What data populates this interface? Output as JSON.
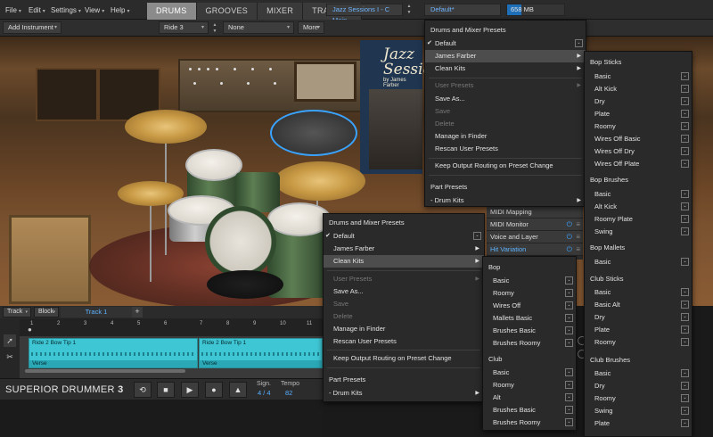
{
  "topbar": {
    "menus": [
      {
        "label": "File"
      },
      {
        "label": "Edit"
      },
      {
        "label": "Settings"
      },
      {
        "label": "View"
      },
      {
        "label": "Help"
      }
    ],
    "tabs": [
      {
        "label": "DRUMS",
        "active": true
      },
      {
        "label": "GROOVES"
      },
      {
        "label": "MIXER"
      },
      {
        "label": "TRACKER"
      }
    ],
    "library": "Jazz Sessions I - C Main",
    "preset": "Default*",
    "memory": "658 MB",
    "accent": "#3aa2ff"
  },
  "toolbar2": {
    "add_instrument": "Add Instrument",
    "instrument": "Ride 3",
    "articulation": "None",
    "more": "More"
  },
  "stage": {
    "album_title": "Jazz Sessions",
    "album_by": "by James Farber"
  },
  "track": {
    "track_select": "Track",
    "block_select": "Block",
    "track_name": "Track 1",
    "add_label": "+",
    "ruler": [
      "1",
      "2",
      "3",
      "4",
      "5",
      "6",
      "7",
      "8",
      "9",
      "10",
      "11"
    ],
    "clips": [
      {
        "name": "Ride 2 Bow Tip 1",
        "section": "Verse"
      },
      {
        "name": "Ride 2 Bow Tip 1",
        "section": "Verse"
      }
    ]
  },
  "transport": {
    "logo": "SUPERIOR DRUMMER",
    "logo_num": "3",
    "loop_icon": "⟲",
    "stop_icon": "■",
    "play_icon": "▶",
    "record_icon": "●",
    "metronome_icon": "▲",
    "sign_label": "Sign.",
    "sign_value": "4 / 4",
    "tempo_label": "Tempo",
    "tempo_value": "82"
  },
  "right_panel": {
    "items": [
      "MIDI Mapping",
      "MIDI Monitor",
      "Voice and Layer",
      "Hit Variation"
    ]
  },
  "menu_a": {
    "header": "Drums and Mixer Presets",
    "items": [
      "Default",
      "James Farber",
      "Clean Kits"
    ],
    "user_presets": "User Presets",
    "save_as": "Save As...",
    "save": "Save",
    "delete": "Delete",
    "manage": "Manage in Finder",
    "rescan": "Rescan User Presets",
    "keep_routing": "Keep Output Routing on Preset Change",
    "part_presets": "Part Presets",
    "drum_kits": "Drum Kits"
  },
  "menu_b": {
    "groups": [
      {
        "title": "Bop Sticks",
        "items": [
          "Basic",
          "Alt Kick",
          "Dry",
          "Plate",
          "Roomy",
          "Wires Off Basic",
          "Wires Off Dry",
          "Wires Off Plate"
        ]
      },
      {
        "title": "Bop Brushes",
        "items": [
          "Basic",
          "Alt Kick",
          "Roomy Plate",
          "Swing"
        ]
      },
      {
        "title": "Bop Mallets",
        "items": [
          "Basic"
        ]
      },
      {
        "title": "Club Sticks",
        "items": [
          "Basic",
          "Basic Alt",
          "Dry",
          "Plate",
          "Roomy"
        ]
      },
      {
        "title": "Club Brushes",
        "items": [
          "Basic",
          "Dry",
          "Roomy",
          "Swing",
          "Plate"
        ]
      }
    ]
  },
  "menu_c": {
    "header": "Drums and Mixer Presets",
    "items": [
      "Default",
      "James Farber",
      "Clean Kits"
    ],
    "user_presets": "User Presets",
    "save_as": "Save As...",
    "save": "Save",
    "delete": "Delete",
    "manage": "Manage in Finder",
    "rescan": "Rescan User Presets",
    "keep_routing": "Keep Output Routing on Preset Change",
    "part_presets": "Part Presets",
    "drum_kits": "Drum Kits"
  },
  "menu_d": {
    "groups": [
      {
        "title": "Bop",
        "items": [
          "Basic",
          "Roomy",
          "Wires Off",
          "Mallets Basic",
          "Brushes Basic",
          "Brushes Roomy"
        ]
      },
      {
        "title": "Club",
        "items": [
          "Basic",
          "Roomy",
          "Alt",
          "Brushes Basic",
          "Brushes Roomy"
        ]
      }
    ]
  },
  "icons": {
    "check": "✔",
    "submenu": "▶",
    "dropdown": "⌄",
    "caret": "▾",
    "power": "⏻",
    "handle": "≡",
    "bullet": "-"
  }
}
